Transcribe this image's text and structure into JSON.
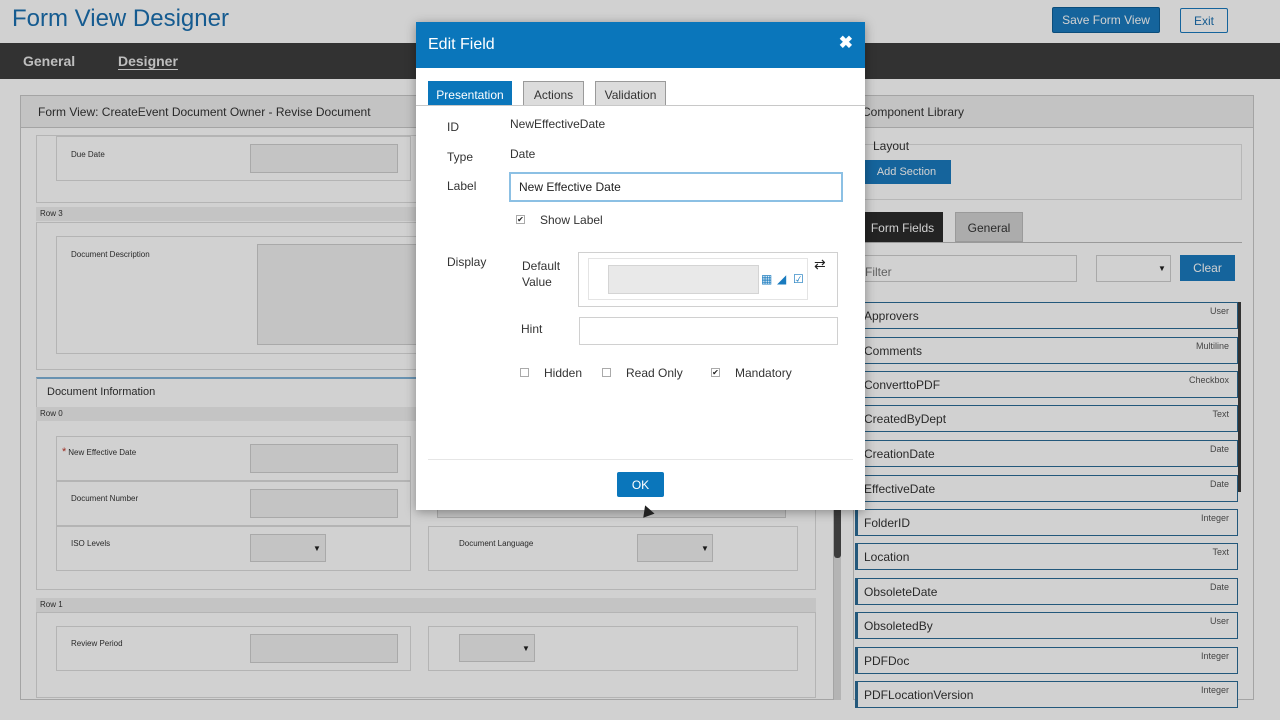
{
  "app": {
    "title": "Form View Designer",
    "save_label": "Save Form View",
    "exit_label": "Exit"
  },
  "nav": {
    "items": [
      {
        "label": "General"
      },
      {
        "label": "Designer"
      }
    ]
  },
  "form_panel": {
    "title": "Form View: CreateEvent Document Owner - Revise Document",
    "fields": {
      "due_date": "Due Date",
      "row3": "Row 3",
      "doc_description": "Document Description",
      "doc_info": "Document Information",
      "row0": "Row 0",
      "new_effective_date": "New Effective Date",
      "required_mark": "*",
      "doc_number": "Document Number",
      "iso_levels": "ISO Levels",
      "doc_language": "Document Language",
      "row1": "Row 1",
      "review_period": "Review Period"
    }
  },
  "component_library": {
    "title": "Component Library",
    "layout_title": "Layout",
    "add_section_label": "Add Section",
    "tabs": [
      {
        "label": "Form Fields"
      },
      {
        "label": "General"
      }
    ],
    "filter_placeholder": "Filter",
    "clear_label": "Clear",
    "items": [
      {
        "name": "Approvers",
        "type": "User"
      },
      {
        "name": "Comments",
        "type": "Multiline"
      },
      {
        "name": "ConverttoPDF",
        "type": "Checkbox"
      },
      {
        "name": "CreatedByDept",
        "type": "Text"
      },
      {
        "name": "CreationDate",
        "type": "Date"
      },
      {
        "name": "EffectiveDate",
        "type": "Date"
      },
      {
        "name": "FolderID",
        "type": "Integer"
      },
      {
        "name": "Location",
        "type": "Text"
      },
      {
        "name": "ObsoleteDate",
        "type": "Date"
      },
      {
        "name": "ObsoletedBy",
        "type": "User"
      },
      {
        "name": "PDFDoc",
        "type": "Integer"
      },
      {
        "name": "PDFLocationVersion",
        "type": "Integer"
      }
    ]
  },
  "modal": {
    "title": "Edit Field",
    "close_glyph": "✖",
    "tabs": [
      {
        "label": "Presentation"
      },
      {
        "label": "Actions"
      },
      {
        "label": "Validation"
      }
    ],
    "id_label": "ID",
    "id_value": "NewEffectiveDate",
    "type_label": "Type",
    "type_value": "Date",
    "label_label": "Label",
    "label_value": "New Effective Date",
    "show_label": "Show Label",
    "show_label_checked": true,
    "display_label": "Display",
    "default_value_label": "Default Value",
    "hint_label": "Hint",
    "hidden_label": "Hidden",
    "read_only_label": "Read Only",
    "mandatory_label": "Mandatory",
    "hidden_checked": false,
    "read_only_checked": false,
    "mandatory_checked": true,
    "ok_label": "OK",
    "check_glyph": "✔"
  }
}
